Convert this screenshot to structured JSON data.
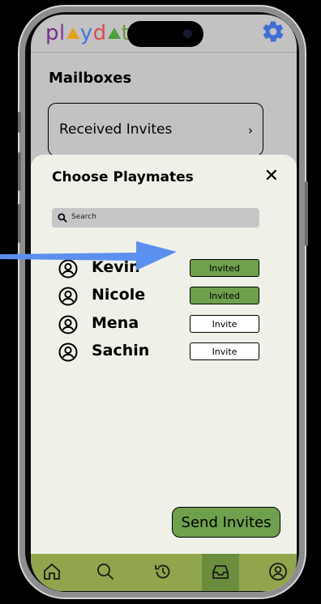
{
  "app": {
    "logo_letters": {
      "p": "p",
      "l": "l",
      "y": "y",
      "d": "d",
      "t": "t"
    },
    "logo_text": "playdate"
  },
  "mailboxes": {
    "title": "Mailboxes",
    "received_label": "Received Invites",
    "received_chevron": "›"
  },
  "sheet": {
    "title": "Choose Playmates",
    "close_label": "✕",
    "search_placeholder": "Search",
    "playmates": [
      {
        "name": "Kevin",
        "status": "Invited"
      },
      {
        "name": "Nicole",
        "status": "Invited"
      },
      {
        "name": "Mena",
        "status": "Invite"
      },
      {
        "name": "Sachin",
        "status": "Invite"
      }
    ],
    "send_label": "Send Invites"
  },
  "tabbar": {
    "tabs": [
      {
        "icon": "home-icon"
      },
      {
        "icon": "search-icon"
      },
      {
        "icon": "history-icon"
      },
      {
        "icon": "inbox-icon",
        "active": true
      },
      {
        "icon": "profile-icon"
      }
    ]
  },
  "colors": {
    "accent_green": "#6ea04e",
    "tabbar_green": "#91a54c",
    "sheet_bg": "#eff1e8",
    "annotation_arrow": "#5b8ff0"
  }
}
